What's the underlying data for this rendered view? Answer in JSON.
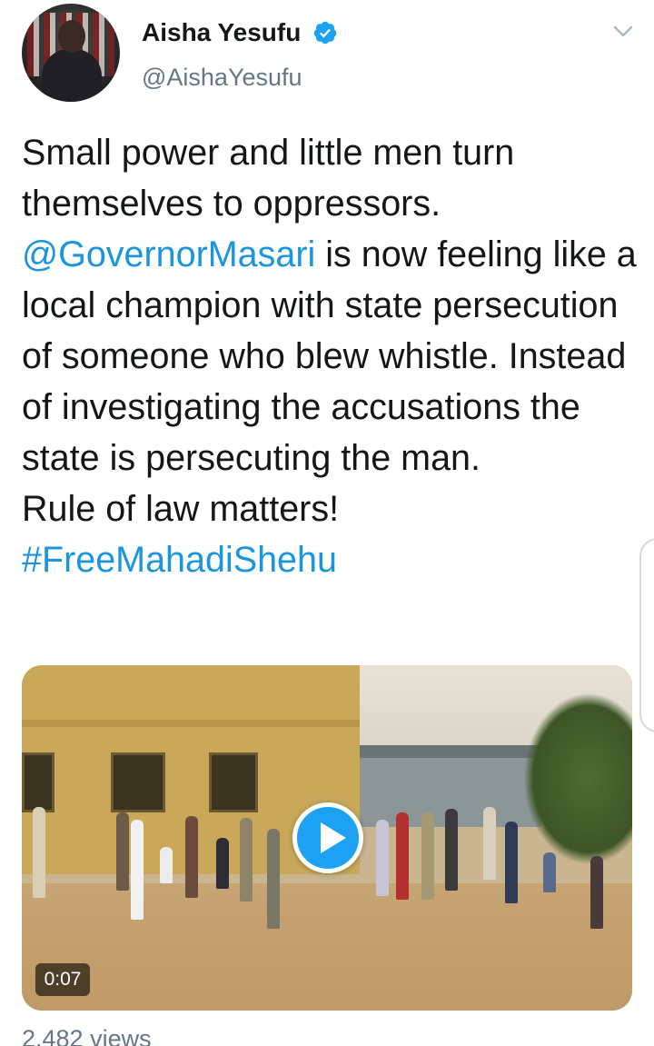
{
  "author": {
    "name": "Aisha Yesufu",
    "handle": "@AishaYesufu",
    "verified": true,
    "avatar_icon": "profile-photo"
  },
  "tweet": {
    "text_before_mention": "Small power and little men turn themselves to oppressors.",
    "mention": "@GovernorMasari",
    "text_after_mention": " is now feeling like a local champion with state persecution of someone who blew whistle. Instead of investigating the accusations the state is persecuting the man.",
    "line_rule_of_law": "Rule of law matters!",
    "hashtag": "#FreeMahadiShehu"
  },
  "media": {
    "type": "video",
    "duration": "0:07",
    "play_icon": "play-icon"
  },
  "stats": {
    "views": "2,482 views"
  },
  "colors": {
    "link": "#1b95e0",
    "verified": "#1da1f2",
    "secondary_text": "#657786",
    "primary_text": "#14171a"
  }
}
